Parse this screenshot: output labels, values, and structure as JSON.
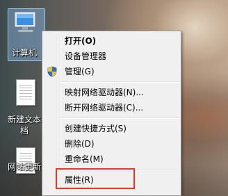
{
  "desktop": {
    "icons": [
      {
        "label": "计算机",
        "icon": "computer-icon"
      },
      {
        "label": "新建文本文档",
        "line1": "新建文本",
        "line2": "档",
        "icon": "text-document-icon"
      },
      {
        "label": "网站更新",
        "icon": "text-document-icon"
      }
    ]
  },
  "context_menu": {
    "items": [
      {
        "label": "打开(O)",
        "bold": true
      },
      {
        "label": "设备管理器"
      },
      {
        "label": "管理(G)",
        "icon": "uac-shield-icon"
      },
      {
        "label": "映射网络驱动器(N)..."
      },
      {
        "label": "断开网络驱动器(C)..."
      },
      {
        "label": "创建快捷方式(S)"
      },
      {
        "label": "删除(D)"
      },
      {
        "label": "重命名(M)"
      },
      {
        "label": "属性(R)",
        "annotated": true
      }
    ]
  },
  "annotation": {
    "color": "#e8362f"
  }
}
